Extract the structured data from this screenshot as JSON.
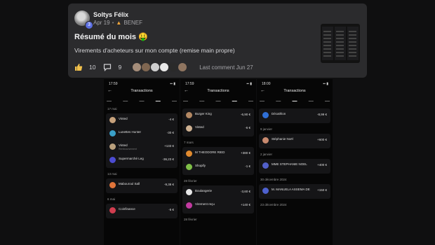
{
  "post": {
    "author": "Soltys Félix",
    "avatar_badge": "3",
    "date": "Apr 19",
    "category": "BENEF",
    "title": "Résumé du mois 🤑",
    "body": "Virements d'acheteurs sur mon compte (remise main propre)",
    "likes": "10",
    "comments": "9",
    "last_comment": "Last comment Jun 27",
    "participant_colors": [
      "#a58d7a",
      "#7f6651",
      "#cfcfcf",
      "#e9e9e9",
      "#2a2a2a",
      "#8f7560"
    ]
  },
  "screenshots": [
    {
      "time": "17:59",
      "header": "Transactions",
      "tabs": [
        "",
        "",
        "",
        "",
        ""
      ],
      "active_tab": 3,
      "sections": [
        {
          "date": "17 mai",
          "date_r": "",
          "items": [
            {
              "name": "Vinted",
              "sub": "",
              "amount": "-4 €",
              "color": "#c7a27c"
            },
            {
              "name": "Lunettes Hunter",
              "sub": "",
              "amount": "-30 €",
              "color": "#3aa0c8"
            },
            {
              "name": "Vinted",
              "sub": "Remboursement",
              "amount": "+133 €",
              "color": "#b9a07d"
            },
            {
              "name": "Supermarché Leg",
              "sub": "",
              "amount": "-36,23 €",
              "color": "#4b4bd1"
            }
          ]
        },
        {
          "date": "13 mai",
          "date_r": "",
          "items": [
            {
              "name": "Mabouroul Sall",
              "sub": "",
              "amount": "-9,38 €",
              "color": "#e0743a"
            }
          ]
        },
        {
          "date": "6 mai",
          "date_r": "",
          "items": [
            {
              "name": "Coinfinance",
              "sub": "",
              "amount": "-5 €",
              "color": "#d13d4f"
            }
          ]
        }
      ]
    },
    {
      "time": "17:59",
      "header": "Transactions",
      "tabs": [
        "",
        "",
        "",
        "",
        ""
      ],
      "active_tab": 3,
      "sections": [
        {
          "date": "",
          "date_r": "",
          "items": [
            {
              "name": "Burger King",
              "sub": "",
              "amount": "-6,90 €",
              "color": "#b38863"
            },
            {
              "name": "Vinted",
              "sub": "",
              "amount": "-6 €",
              "color": "#cdb091"
            }
          ]
        },
        {
          "date": "7 mars",
          "date_r": "",
          "items": [
            {
              "name": "M THEODORE RIED",
              "sub": "",
              "amount": "+380 €",
              "color": "#e08a2e"
            },
            {
              "name": "Shopify",
              "sub": "",
              "amount": "-1 €",
              "color": "#7fbf47"
            }
          ]
        },
        {
          "date": "28 février",
          "date_r": "",
          "items": [
            {
              "name": "Boulangerie",
              "sub": "",
              "amount": "-3,60 €",
              "color": "#e7e7e7"
            },
            {
              "name": "Virement reçu",
              "sub": "",
              "amount": "+140 €",
              "color": "#c23aa0"
            }
          ]
        },
        {
          "date": "28 février",
          "date_r": "",
          "items": []
        }
      ]
    },
    {
      "time": "18:00",
      "header": "Transactions",
      "tabs": [
        "",
        "",
        "",
        "",
        ""
      ],
      "active_tab": 2,
      "sections": [
        {
          "date": "",
          "date_r": "",
          "items": [
            {
              "name": "Décathlon",
              "sub": "",
              "amount": "-8,99 €",
              "color": "#2f6fd6"
            }
          ]
        },
        {
          "date": "9 janvier",
          "date_r": "",
          "items": [
            {
              "name": "Stéphanie Noël",
              "sub": "",
              "amount": "+600 €",
              "color": "#c98a6f"
            }
          ]
        },
        {
          "date": "2 janvier",
          "date_r": "",
          "items": [
            {
              "name": "MME STEPHANIE NOEL",
              "sub": "",
              "amount": "+400 €",
              "color": "#5260c9"
            }
          ]
        },
        {
          "date": "30 décembre 2024",
          "date_r": "",
          "items": [
            {
              "name": "M. MANUELA ASSEMA DE",
              "sub": "",
              "amount": "+150 €",
              "color": "#4e61cf"
            }
          ]
        },
        {
          "date": "23 décembre 2024",
          "date_r": "",
          "items": []
        }
      ]
    }
  ]
}
